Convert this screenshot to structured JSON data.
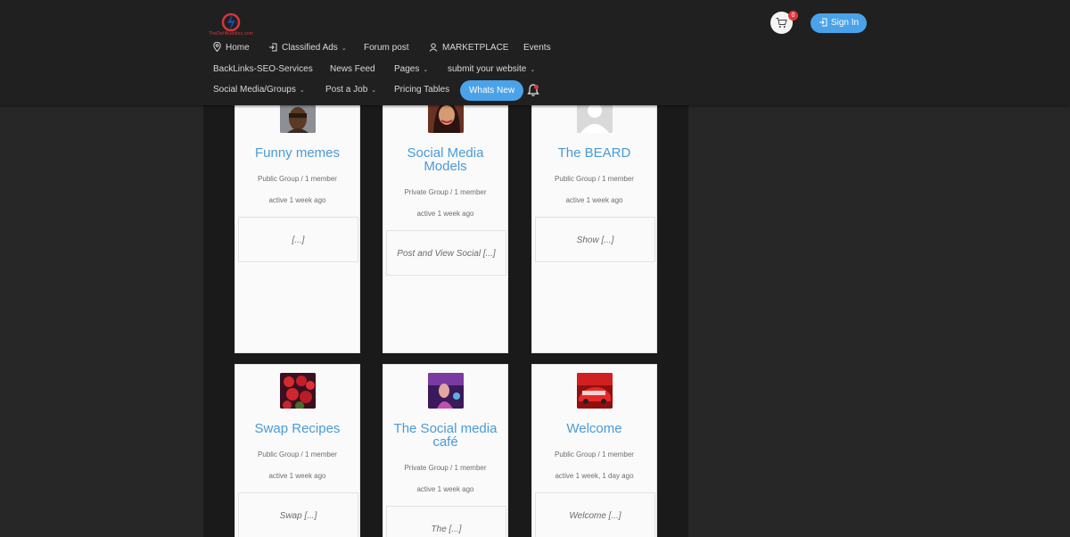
{
  "brand": {
    "logo_text": "TheDefiBuddies.com"
  },
  "nav": {
    "row1": [
      {
        "label": "Home",
        "icon": "map-pin-icon"
      },
      {
        "label": "Classified Ads",
        "icon": "login-icon",
        "has_dropdown": true
      },
      {
        "label": "Forum post"
      },
      {
        "label": "MARKETPLACE",
        "icon": "user-icon"
      },
      {
        "label": "Events"
      }
    ],
    "row2": [
      {
        "label": "BackLinks-SEO-Services"
      },
      {
        "label": "News Feed"
      },
      {
        "label": "Pages",
        "has_dropdown": true
      },
      {
        "label": "submit your website",
        "has_dropdown": true
      }
    ],
    "row3": [
      {
        "label": "Social Media/Groups",
        "has_dropdown": true
      },
      {
        "label": "Post a Job",
        "has_dropdown": true
      },
      {
        "label": "Pricing Tables"
      }
    ],
    "whats_new": "Whats New"
  },
  "cart": {
    "count": "0"
  },
  "signin": {
    "label": "Sign In"
  },
  "groups": [
    {
      "name": "Funny memes",
      "meta": "Public Group / 1 member",
      "activity": "active 1 week ago",
      "desc": "[...]",
      "avatar": "face-photo"
    },
    {
      "name": "Social Media Models",
      "meta": "Private Group / 1 member",
      "activity": "active 1 week ago",
      "desc": "Post and View Social [...]",
      "avatar": "model-photo"
    },
    {
      "name": "The BEARD",
      "meta": "Public Group / 1 member",
      "activity": "active 1 week ago",
      "desc": "Show [...]",
      "avatar": "default-avatar"
    },
    {
      "name": "Swap Recipes",
      "meta": "Public Group / 1 member",
      "activity": "active 1 week ago",
      "desc": "Swap [...]",
      "avatar": "strawberries-photo"
    },
    {
      "name": "The Social media café",
      "meta": "Private Group / 1 member",
      "activity": "active 1 week ago",
      "desc": "The [...]",
      "avatar": "cafe-photo"
    },
    {
      "name": "Welcome",
      "meta": "Public Group / 1 member",
      "activity": "active 1 week, 1 day ago",
      "desc": "Welcome [...]",
      "avatar": "red-car-photo"
    }
  ],
  "colors": {
    "accent": "#4aa3e8",
    "title": "#4a9ad6",
    "header_bg": "#202020",
    "page_bg": "#272727",
    "badge": "#e0343b"
  }
}
